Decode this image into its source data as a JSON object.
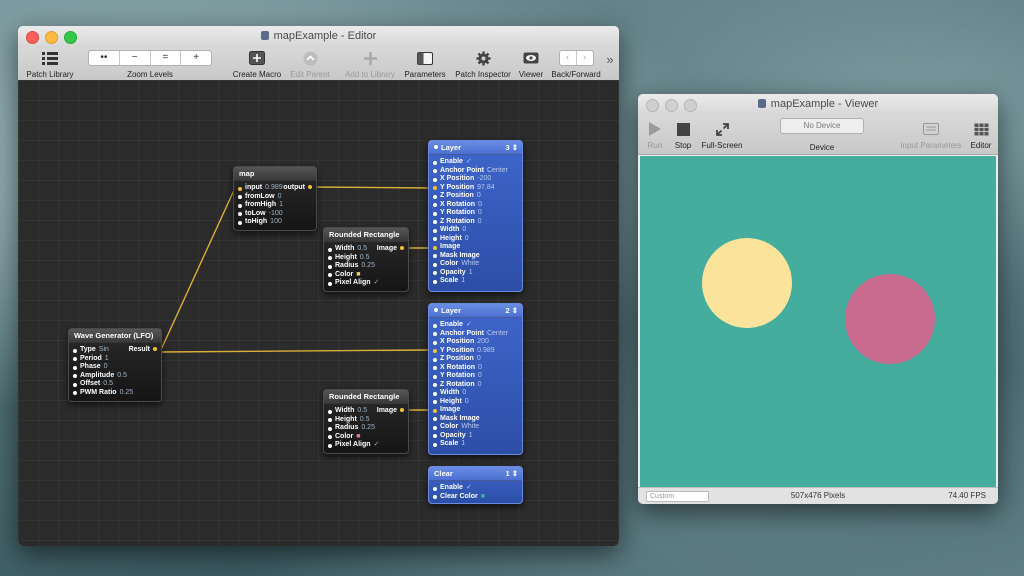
{
  "editor": {
    "title": "mapExample - Editor",
    "toolbar": {
      "patch_library": "Patch Library",
      "zoom_levels": "Zoom Levels",
      "zoom_buttons": [
        "••",
        "−",
        "=",
        "+"
      ],
      "create_macro": "Create Macro",
      "edit_parent": "Edit Parent",
      "add_to_library": "Add to Library",
      "parameters": "Parameters",
      "patch_inspector": "Patch Inspector",
      "viewer": "Viewer",
      "back_forward": "Back/Forward",
      "overflow": "»"
    },
    "patches": {
      "map": {
        "title": "map",
        "output": "output",
        "rows": [
          {
            "label": "input",
            "value": "0.989"
          },
          {
            "label": "fromLow",
            "value": "0"
          },
          {
            "label": "fromHigh",
            "value": "1"
          },
          {
            "label": "toLow",
            "value": "-100"
          },
          {
            "label": "toHigh",
            "value": "100"
          }
        ]
      },
      "wave": {
        "title": "Wave Generator (LFO)",
        "output": "Result",
        "rows": [
          {
            "label": "Type",
            "value": "Sin"
          },
          {
            "label": "Period",
            "value": "1"
          },
          {
            "label": "Phase",
            "value": "0"
          },
          {
            "label": "Amplitude",
            "value": "0.5"
          },
          {
            "label": "Offset",
            "value": "0.5"
          },
          {
            "label": "PWM Ratio",
            "value": "0.25"
          }
        ]
      },
      "rect1": {
        "title": "Rounded Rectangle",
        "output": "Image",
        "rows": [
          {
            "label": "Width",
            "value": "0.5"
          },
          {
            "label": "Height",
            "value": "0.5"
          },
          {
            "label": "Radius",
            "value": "0.25"
          },
          {
            "label": "Color",
            "value": "■",
            "color": "#f5d06a"
          },
          {
            "label": "Pixel Align",
            "value": "✓"
          }
        ]
      },
      "rect2": {
        "title": "Rounded Rectangle",
        "output": "Image",
        "rows": [
          {
            "label": "Width",
            "value": "0.5"
          },
          {
            "label": "Height",
            "value": "0.5"
          },
          {
            "label": "Radius",
            "value": "0.25"
          },
          {
            "label": "Color",
            "value": "■",
            "color": "#e07a9a"
          },
          {
            "label": "Pixel Align",
            "value": "✓"
          }
        ]
      },
      "layer3": {
        "title": "Layer",
        "count": "3 ⇕",
        "rows": [
          {
            "label": "Enable",
            "value": "✓"
          },
          {
            "label": "Anchor Point",
            "value": "Center"
          },
          {
            "label": "X Position",
            "value": "-200"
          },
          {
            "label": "Y Position",
            "value": "97.84"
          },
          {
            "label": "Z Position",
            "value": "0"
          },
          {
            "label": "X Rotation",
            "value": "0"
          },
          {
            "label": "Y Rotation",
            "value": "0"
          },
          {
            "label": "Z Rotation",
            "value": "0"
          },
          {
            "label": "Width",
            "value": "0"
          },
          {
            "label": "Height",
            "value": "0"
          },
          {
            "label": "Image",
            "value": ""
          },
          {
            "label": "Mask Image",
            "value": ""
          },
          {
            "label": "Color",
            "value": "White"
          },
          {
            "label": "Opacity",
            "value": "1"
          },
          {
            "label": "Scale",
            "value": "1"
          }
        ]
      },
      "layer2": {
        "title": "Layer",
        "count": "2 ⇕",
        "rows": [
          {
            "label": "Enable",
            "value": "✓"
          },
          {
            "label": "Anchor Point",
            "value": "Center"
          },
          {
            "label": "X Position",
            "value": "200"
          },
          {
            "label": "Y Position",
            "value": "0.989"
          },
          {
            "label": "Z Position",
            "value": "0"
          },
          {
            "label": "X Rotation",
            "value": "0"
          },
          {
            "label": "Y Rotation",
            "value": "0"
          },
          {
            "label": "Z Rotation",
            "value": "0"
          },
          {
            "label": "Width",
            "value": "0"
          },
          {
            "label": "Height",
            "value": "0"
          },
          {
            "label": "Image",
            "value": ""
          },
          {
            "label": "Mask Image",
            "value": ""
          },
          {
            "label": "Color",
            "value": "White"
          },
          {
            "label": "Opacity",
            "value": "1"
          },
          {
            "label": "Scale",
            "value": "1"
          }
        ]
      },
      "clear": {
        "title": "Clear",
        "count": "1 ⇕",
        "rows": [
          {
            "label": "Enable",
            "value": "✓"
          },
          {
            "label": "Clear Color",
            "value": "■",
            "color": "#44ad9e"
          }
        ]
      }
    }
  },
  "viewer": {
    "title": "mapExample - Viewer",
    "toolbar": {
      "run": "Run",
      "stop": "Stop",
      "fullscreen": "Full-Screen",
      "device_value": "No Device",
      "device_label": "Device",
      "input_parameters": "Input Parameters",
      "editor": "Editor"
    },
    "status": {
      "size_select": "Custom",
      "dimensions": "507x476 Pixels",
      "fps": "74.40 FPS"
    },
    "colors": {
      "background": "#44ad9e",
      "circle_left": "#fbe39c",
      "circle_right": "#c86b8f"
    }
  }
}
